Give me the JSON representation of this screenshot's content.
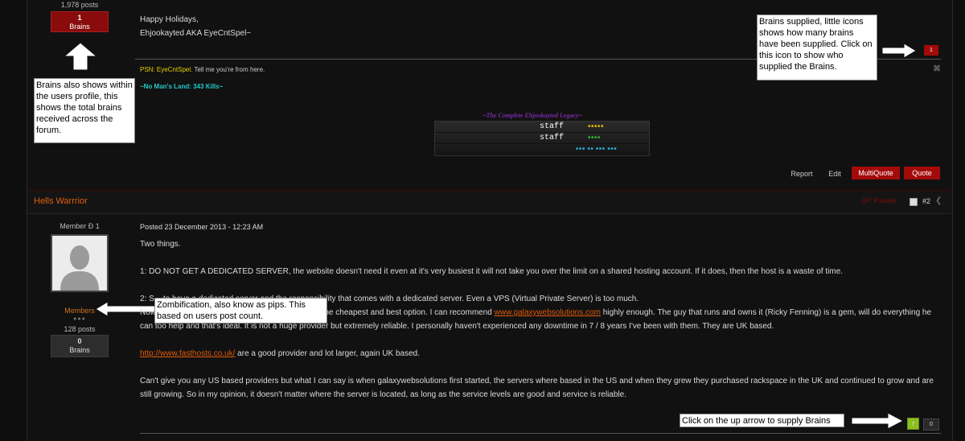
{
  "post1": {
    "user_posts": "1,978 posts",
    "brains_count": "1",
    "brains_label": "Brains",
    "body_lines": [
      "Happy Holidays,",
      "Ehjookayted AKA EyeCntSpel~"
    ],
    "sig_psn_label": "PSN: EyeCntSpel.",
    "sig_psn_rest": "Tell me you're from here.",
    "sig_kills": "~No Man's Land: 343 Kills~",
    "sig_banner_title": "~The Complete Ehjookayted Legacy~",
    "sig_staff1": "staff",
    "sig_staff2": "staff",
    "brain_counter": "1",
    "actions": {
      "report": "Report",
      "edit": "Edit",
      "multiquote": "MultiQuote",
      "quote": "Quote"
    }
  },
  "post2": {
    "username": "Hells Warrrior",
    "ip_label": "(IP: Private)",
    "post_number": "#2",
    "user_title": "Member Ð 1",
    "group": "Members",
    "posts": "128 posts",
    "brains_count": "0",
    "brains_label": "Brains",
    "posted": "Posted 23 December 2013 - 12:23 AM",
    "p1": "Two things.",
    "p2": "1: DO NOT GET A DEDICATED SERVER, the website doesn't need it even at it's very busiest it will not take you over the limit on a shared hosting account. If it does, then the host is a waste of time.",
    "p3": "2: S... to have a dedicated server and the responsibility that comes with a dedicated server. Even a VPS (Virtual Private Server) is too much.",
    "p4_a": "Now, cost. The cost of a shared hosting provider is the cheapest and best option. I can recommend",
    "p4_link": "www.galaxywebsolutions.com",
    "p4_b": "highly enough. The guy that runs and owns it (Ricky Fenning) is a gem, will do everything he can too help and that's ideal. It is not a huge provider but extremely reliable. I personally haven't experienced any downtime in 7 / 8 years I've been with them. They are UK based.",
    "p5_link": "http://www.fasthosts.co.uk/",
    "p5_rest": "are a good provider and lot larger, again UK based.",
    "p6": "Can't give you any US based providers but what I can say is when galaxywebsolutions first started, the servers where based in the US and when they grew they purchased rackspace in the UK and continued to grow and are still growing. So in my opinion, it doesn't matter where the server is located, as long as the service levels are good and service is reliable.",
    "brain_counter": "0"
  },
  "notes": {
    "brains_supplied": "Brains supplied, little icons shows how many brains have been supplied. Click on this icon to show who supplied the Brains.",
    "brains_profile": "Brains also shows within the users profile, this shows the total brains received across the forum.",
    "pips": "Zombification, also know as pips. This based on users post count.",
    "up_arrow": "Click on the up arrow to supply Brains"
  },
  "colors": {
    "accent_red": "#a30a0a",
    "link_orange": "#e05a0a",
    "psn_yellow": "#e8d000",
    "kills_cyan": "#22c8c8",
    "username_orange": "#e06010"
  }
}
